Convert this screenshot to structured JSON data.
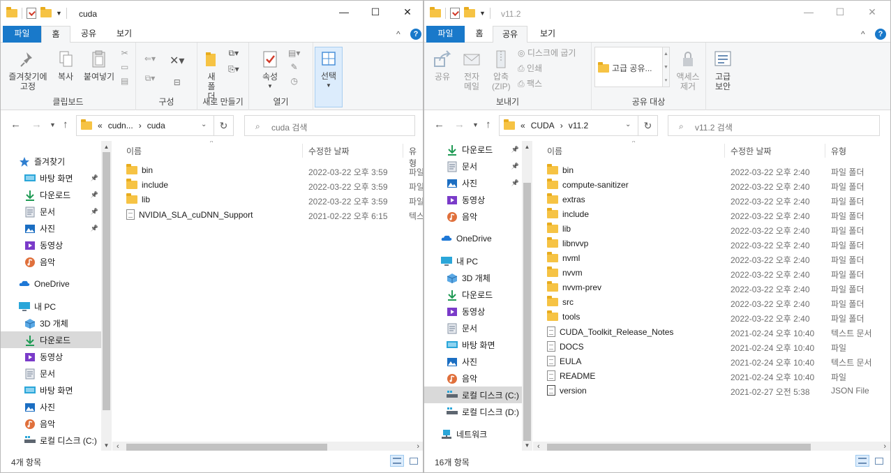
{
  "ribbon_tabs": {
    "file": "파일",
    "home": "홈",
    "share": "공유",
    "view": "보기"
  },
  "help_icon": "?",
  "collapse_icon": "^",
  "window_left": {
    "title": "cuda",
    "minimize": "—",
    "maximize": "☐",
    "close": "✕",
    "ribbon": {
      "pin": "즐겨찾기에 고정",
      "copy": "복사",
      "paste": "붙여넣기",
      "clipboard_group": "클립보드",
      "organize_group": "구성",
      "new_folder": "새 폴더",
      "new_group": "새로 만들기",
      "properties": "속성",
      "open_group": "열기",
      "select": "선택"
    },
    "address": {
      "prefix": "«",
      "crumbs": [
        "cudn...",
        "cuda"
      ],
      "search_placeholder": "cuda 검색"
    },
    "nav_items": [
      {
        "label": "즐겨찾기",
        "icon": "star-icon",
        "pinned": false
      },
      {
        "label": "바탕 화면",
        "icon": "desktop-icon",
        "pinned": true
      },
      {
        "label": "다운로드",
        "icon": "download-icon",
        "pinned": true
      },
      {
        "label": "문서",
        "icon": "documents-icon",
        "pinned": true
      },
      {
        "label": "사진",
        "icon": "pictures-icon",
        "pinned": true
      },
      {
        "label": "동영상",
        "icon": "videos-icon",
        "pinned": false
      },
      {
        "label": "음악",
        "icon": "music-icon",
        "pinned": false
      },
      {
        "label": "OneDrive",
        "icon": "onedrive-icon",
        "pinned": false
      },
      {
        "label": "내 PC",
        "icon": "pc-icon",
        "pinned": false
      },
      {
        "label": "3D 개체",
        "icon": "3d-objects-icon",
        "pinned": false
      },
      {
        "label": "다운로드",
        "icon": "download-icon",
        "pinned": false
      },
      {
        "label": "동영상",
        "icon": "videos-icon",
        "pinned": false
      },
      {
        "label": "문서",
        "icon": "documents-icon",
        "pinned": false
      },
      {
        "label": "바탕 화면",
        "icon": "desktop-icon",
        "pinned": false
      },
      {
        "label": "사진",
        "icon": "pictures-icon",
        "pinned": false
      },
      {
        "label": "음악",
        "icon": "music-icon",
        "pinned": false
      },
      {
        "label": "로컬 디스크 (C:)",
        "icon": "drive-icon",
        "pinned": false
      }
    ],
    "columns": {
      "name": "이름",
      "date": "수정한 날짜",
      "type": "유형"
    },
    "files": [
      {
        "name": "bin",
        "date": "2022-03-22 오후 3:59",
        "type": "파일",
        "kind": "folder"
      },
      {
        "name": "include",
        "date": "2022-03-22 오후 3:59",
        "type": "파일",
        "kind": "folder"
      },
      {
        "name": "lib",
        "date": "2022-03-22 오후 3:59",
        "type": "파일",
        "kind": "folder"
      },
      {
        "name": "NVIDIA_SLA_cuDNN_Support",
        "date": "2021-02-22 오후 6:15",
        "type": "텍스",
        "kind": "doc"
      }
    ],
    "status": "4개 항목"
  },
  "window_right": {
    "title": "v11.2",
    "minimize": "—",
    "maximize": "☐",
    "close": "✕",
    "ribbon": {
      "share": "공유",
      "email": "전자 메일",
      "zip": "압축 (ZIP)",
      "burn": "디스크에 굽기",
      "print": "인쇄",
      "fax": "팩스",
      "send_group": "보내기",
      "advanced_share": "고급 공유...",
      "share_group": "공유 대상",
      "remove_access": "액세스 제거",
      "advanced_security": "고급 보안"
    },
    "address": {
      "prefix": "«",
      "crumbs": [
        "CUDA",
        "v11.2"
      ],
      "search_placeholder": "v11.2 검색"
    },
    "nav_items": [
      {
        "label": "다운로드",
        "icon": "download-icon",
        "pinned": true
      },
      {
        "label": "문서",
        "icon": "documents-icon",
        "pinned": true
      },
      {
        "label": "사진",
        "icon": "pictures-icon",
        "pinned": true
      },
      {
        "label": "동영상",
        "icon": "videos-icon",
        "pinned": false
      },
      {
        "label": "음악",
        "icon": "music-icon",
        "pinned": false
      },
      {
        "label": "OneDrive",
        "icon": "onedrive-icon",
        "pinned": false
      },
      {
        "label": "내 PC",
        "icon": "pc-icon",
        "pinned": false
      },
      {
        "label": "3D 개체",
        "icon": "3d-objects-icon",
        "pinned": false
      },
      {
        "label": "다운로드",
        "icon": "download-icon",
        "pinned": false
      },
      {
        "label": "동영상",
        "icon": "videos-icon",
        "pinned": false
      },
      {
        "label": "문서",
        "icon": "documents-icon",
        "pinned": false
      },
      {
        "label": "바탕 화면",
        "icon": "desktop-icon",
        "pinned": false
      },
      {
        "label": "사진",
        "icon": "pictures-icon",
        "pinned": false
      },
      {
        "label": "음악",
        "icon": "music-icon",
        "pinned": false
      },
      {
        "label": "로컬 디스크 (C:)",
        "icon": "drive-icon",
        "pinned": false
      },
      {
        "label": "로컬 디스크 (D:)",
        "icon": "drive-icon",
        "pinned": false
      },
      {
        "label": "네트워크",
        "icon": "network-icon",
        "pinned": false
      }
    ],
    "columns": {
      "name": "이름",
      "date": "수정한 날짜",
      "type": "유형"
    },
    "files": [
      {
        "name": "bin",
        "date": "2022-03-22 오후 2:40",
        "type": "파일 폴더",
        "kind": "folder"
      },
      {
        "name": "compute-sanitizer",
        "date": "2022-03-22 오후 2:40",
        "type": "파일 폴더",
        "kind": "folder"
      },
      {
        "name": "extras",
        "date": "2022-03-22 오후 2:40",
        "type": "파일 폴더",
        "kind": "folder"
      },
      {
        "name": "include",
        "date": "2022-03-22 오후 2:40",
        "type": "파일 폴더",
        "kind": "folder"
      },
      {
        "name": "lib",
        "date": "2022-03-22 오후 2:40",
        "type": "파일 폴더",
        "kind": "folder"
      },
      {
        "name": "libnvvp",
        "date": "2022-03-22 오후 2:40",
        "type": "파일 폴더",
        "kind": "folder"
      },
      {
        "name": "nvml",
        "date": "2022-03-22 오후 2:40",
        "type": "파일 폴더",
        "kind": "folder"
      },
      {
        "name": "nvvm",
        "date": "2022-03-22 오후 2:40",
        "type": "파일 폴더",
        "kind": "folder"
      },
      {
        "name": "nvvm-prev",
        "date": "2022-03-22 오후 2:40",
        "type": "파일 폴더",
        "kind": "folder"
      },
      {
        "name": "src",
        "date": "2022-03-22 오후 2:40",
        "type": "파일 폴더",
        "kind": "folder"
      },
      {
        "name": "tools",
        "date": "2022-03-22 오후 2:40",
        "type": "파일 폴더",
        "kind": "folder"
      },
      {
        "name": "CUDA_Toolkit_Release_Notes",
        "date": "2021-02-24 오후 10:40",
        "type": "텍스트 문서",
        "kind": "doc"
      },
      {
        "name": "DOCS",
        "date": "2021-02-24 오후 10:40",
        "type": "파일",
        "kind": "doc"
      },
      {
        "name": "EULA",
        "date": "2021-02-24 오후 10:40",
        "type": "텍스트 문서",
        "kind": "doc"
      },
      {
        "name": "README",
        "date": "2021-02-24 오후 10:40",
        "type": "파일",
        "kind": "doc"
      },
      {
        "name": "version",
        "date": "2021-02-27 오전 5:38",
        "type": "JSON File",
        "kind": "json"
      }
    ],
    "status": "16개 항목"
  },
  "colors": {
    "accent": "#1979ca",
    "folder": "#f6c344",
    "selection": "#cce8ff"
  }
}
